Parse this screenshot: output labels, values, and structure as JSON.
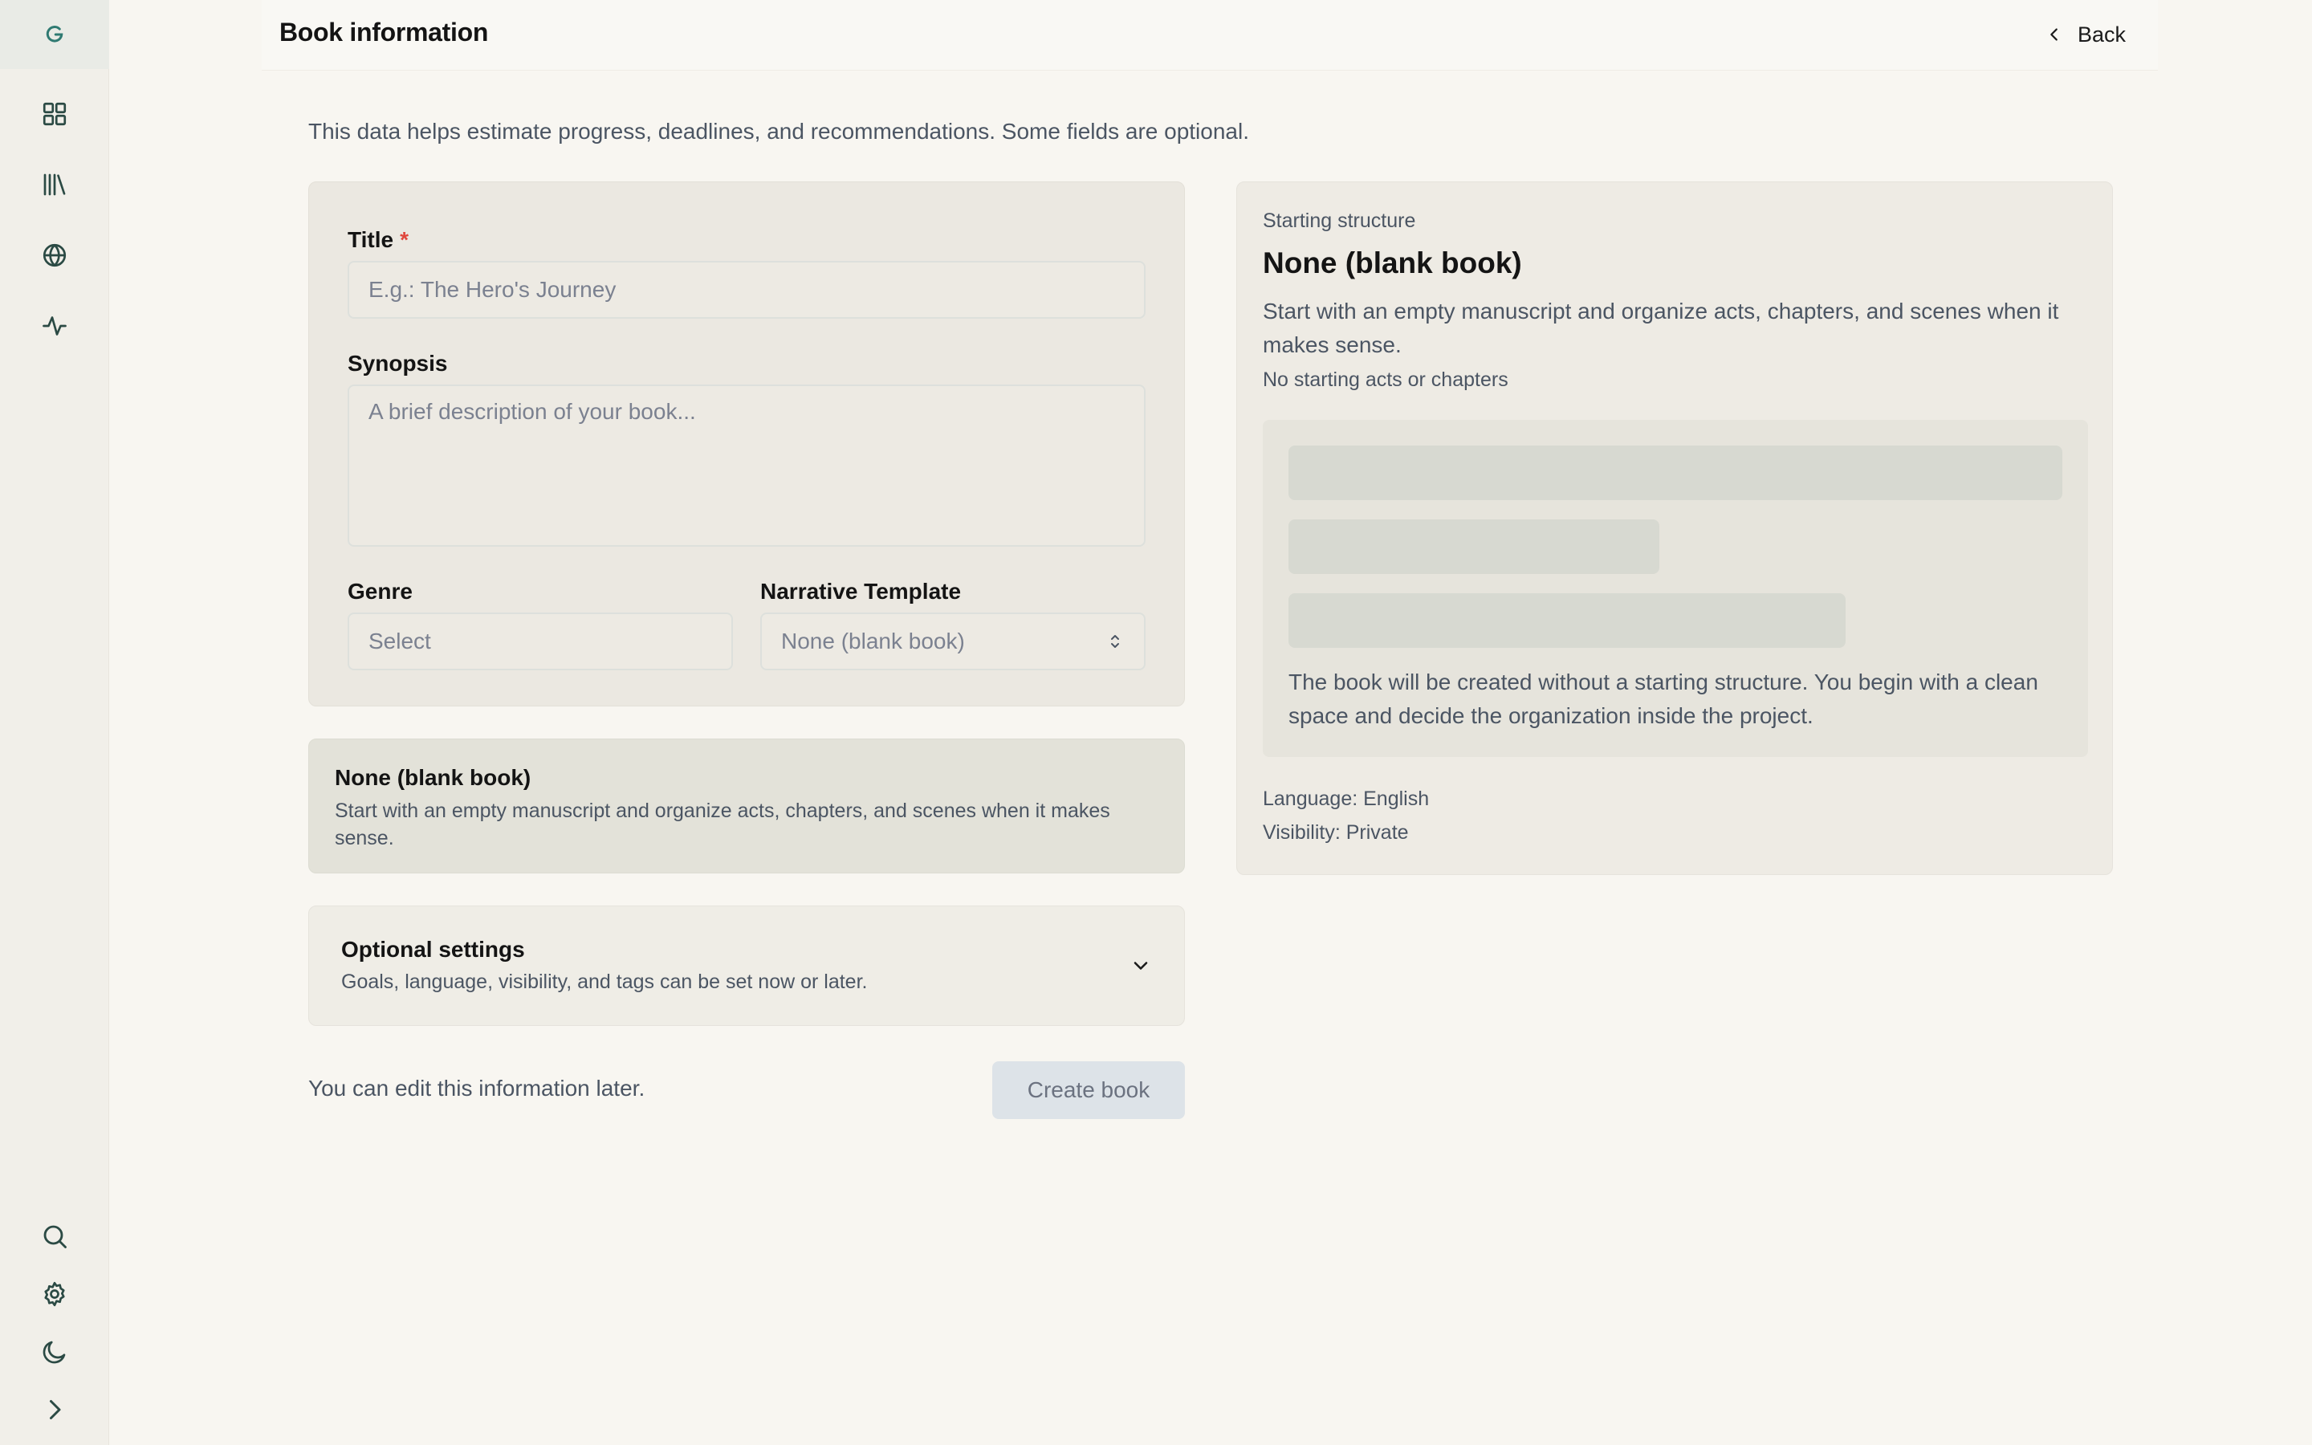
{
  "header": {
    "title": "Book information",
    "back_label": "Back"
  },
  "intro": "This data helps estimate progress, deadlines, and recommendations. Some fields are optional.",
  "form": {
    "title_label": "Title",
    "required_mark": "*",
    "title_placeholder": "E.g.: The Hero's Journey",
    "synopsis_label": "Synopsis",
    "synopsis_placeholder": "A brief description of your book...",
    "genre_label": "Genre",
    "genre_value": "Select",
    "template_label": "Narrative Template",
    "template_value": "None (blank book)"
  },
  "template_card": {
    "title": "None (blank book)",
    "description": "Start with an empty manuscript and organize acts, chapters, and scenes when it makes sense."
  },
  "optional_settings": {
    "title": "Optional settings",
    "description": "Goals, language, visibility, and tags can be set now or later."
  },
  "footer": {
    "note": "You can edit this information later.",
    "create_label": "Create book"
  },
  "structure": {
    "kicker": "Starting structure",
    "title": "None (blank book)",
    "description": "Start with an empty manuscript and organize acts, chapters, and scenes when it makes sense.",
    "note": "No starting acts or chapters",
    "preview_text": "The book will be created without a starting structure. You begin with a clean space and decide the organization inside the project.",
    "language": "Language: English",
    "visibility": "Visibility: Private"
  },
  "sidebar": {
    "logo": "logo-icon",
    "top_items": [
      "dashboard-icon",
      "library-icon",
      "globe-icon",
      "activity-icon"
    ],
    "bottom_items": [
      "search-icon",
      "gear-icon",
      "moon-icon",
      "chevron-right-icon"
    ]
  },
  "colors": {
    "accent": "#2f7a72",
    "icon": "#2b4a44",
    "background": "#f8f6f1",
    "panel": "#ebe8e1",
    "required": "#e0473d"
  }
}
